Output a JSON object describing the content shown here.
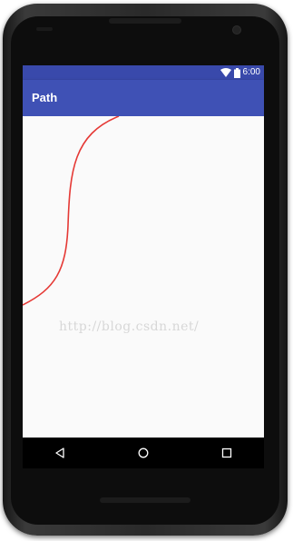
{
  "status_bar": {
    "time": "6:00",
    "icons": [
      "wifi-icon",
      "battery-icon"
    ]
  },
  "app_bar": {
    "title": "Path"
  },
  "canvas": {
    "watermark": "http://blog.csdn.net/",
    "curve_color": "#e53935"
  },
  "nav_bar": {
    "buttons": [
      "back-icon",
      "home-icon",
      "recents-icon"
    ]
  },
  "colors": {
    "status_bar": "#3949ab",
    "app_bar": "#3f51b5",
    "background": "#fafafa"
  }
}
